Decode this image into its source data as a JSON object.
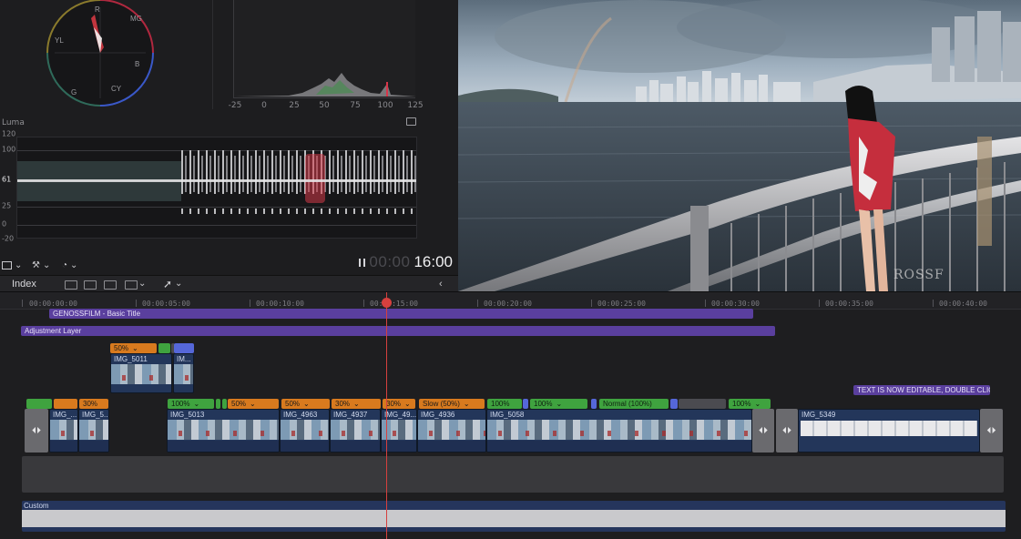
{
  "vectorscope": {
    "targets": [
      "R",
      "MG",
      "B",
      "CY",
      "G",
      "YL"
    ],
    "colors": {
      "ring_red": "#b0283f",
      "ring_blue": "#3a58c8",
      "trace": "#e13b45"
    }
  },
  "histogram": {
    "ticks": [
      "-25",
      "0",
      "25",
      "50",
      "75",
      "100",
      "125"
    ]
  },
  "waveform": {
    "title": "Luma",
    "scale": [
      "120",
      "100",
      "61",
      "25",
      "0",
      "-20"
    ]
  },
  "scope_footer": {
    "timecode_dim": "00:00",
    "timecode_lit": "16:00"
  },
  "viewer": {
    "watermark": "ROSSF"
  },
  "timeline_toolbar": {
    "index_label": "Index",
    "collapse_glyph": "‹"
  },
  "timeline": {
    "ruler": [
      "00:00:00:00",
      "00:00:05:00",
      "00:00:10:00",
      "00:00:15:00",
      "00:00:20:00",
      "00:00:25:00",
      "00:00:30:00",
      "00:00:35:00",
      "00:00:40:00"
    ],
    "title_bar": "GENOSSFILM - Basic Title",
    "adjustment_bar": "Adjustment Layer",
    "connected": {
      "speed_tag": "50%",
      "clips": [
        "IMG_5011",
        "IM..."
      ]
    },
    "primary": {
      "tags": [
        "",
        "",
        "30%",
        "100%",
        "",
        "",
        "50%",
        "50%",
        "30%",
        "30%",
        "Slow (50%)",
        "100%",
        "100%",
        "Normal (100%)",
        "",
        "100%"
      ],
      "clips": [
        "IMG_...",
        "IMG_5...",
        "IMG_5013",
        "IMG_4963",
        "IMG_4937",
        "IMG_49...",
        "IMG_4936",
        "IMG_5058",
        "IMG_5349"
      ],
      "transition_glyph": "⏴⏵"
    },
    "editable_badge": "TEXT IS NOW EDITABLE, DOUBLE CLIC...",
    "custom_label": "Custom"
  }
}
